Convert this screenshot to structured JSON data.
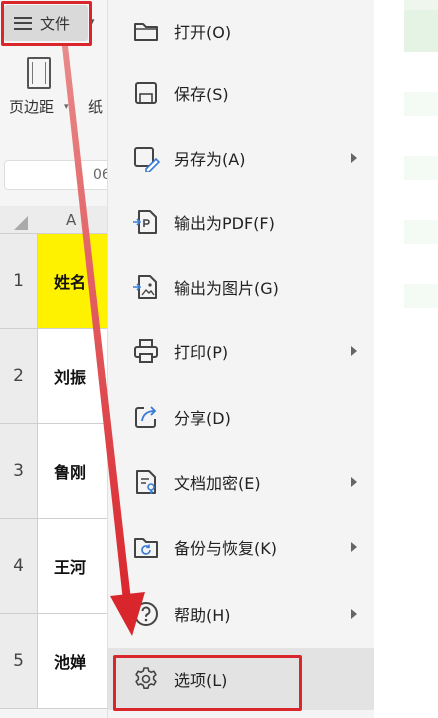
{
  "toolbar": {
    "file_label": "文件",
    "page_margin_label": "页边距",
    "paper_label": "纸"
  },
  "namebox": {
    "value": "06"
  },
  "sheet": {
    "column_a": "A",
    "rows": [
      {
        "num": "1",
        "value": "姓名"
      },
      {
        "num": "2",
        "value": "刘振"
      },
      {
        "num": "3",
        "value": "鲁刚"
      },
      {
        "num": "4",
        "value": "王河"
      },
      {
        "num": "5",
        "value": "池婵"
      }
    ]
  },
  "menu": {
    "items": [
      {
        "label": "打开(O)",
        "icon": "folder-open-icon"
      },
      {
        "label": "保存(S)",
        "icon": "save-icon"
      },
      {
        "label": "另存为(A)",
        "icon": "save-as-icon",
        "submenu": true
      },
      {
        "label": "输出为PDF(F)",
        "icon": "export-pdf-icon"
      },
      {
        "label": "输出为图片(G)",
        "icon": "export-image-icon"
      },
      {
        "label": "打印(P)",
        "icon": "printer-icon",
        "submenu": true
      },
      {
        "label": "分享(D)",
        "icon": "share-icon"
      },
      {
        "label": "文档加密(E)",
        "icon": "document-encrypt-icon",
        "submenu": true
      },
      {
        "label": "备份与恢复(K)",
        "icon": "backup-restore-icon",
        "submenu": true
      },
      {
        "label": "帮助(H)",
        "icon": "help-icon",
        "submenu": true
      },
      {
        "label": "选项(L)",
        "icon": "gear-icon",
        "highlighted": true
      }
    ]
  },
  "colors": {
    "annotation_red": "#d9262d",
    "header_yellow": "#fff200",
    "menu_bg": "#f4f4f4",
    "highlight_bg": "#e3e3e3"
  }
}
